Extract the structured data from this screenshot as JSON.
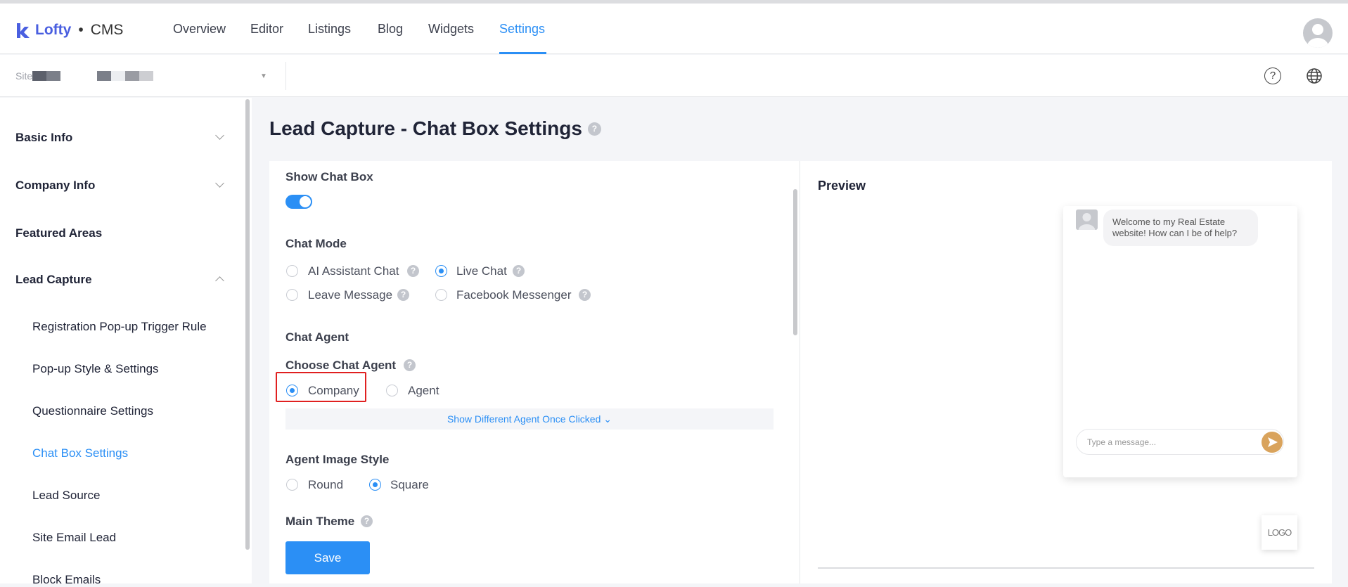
{
  "header": {
    "brand": "Lofty",
    "product": "CMS",
    "separator": "•",
    "nav": [
      "Overview",
      "Editor",
      "Listings",
      "Blog",
      "Widgets",
      "Settings"
    ],
    "active_nav": "Settings"
  },
  "subheader": {
    "site_label": "Site"
  },
  "sidebar": {
    "sections": [
      {
        "label": "Basic Info",
        "expanded": false
      },
      {
        "label": "Company Info",
        "expanded": false
      },
      {
        "label": "Featured Areas"
      },
      {
        "label": "Lead Capture",
        "expanded": true
      }
    ],
    "sub_items": [
      "Registration Pop-up Trigger Rule",
      "Pop-up Style & Settings",
      "Questionnaire Settings",
      "Chat Box Settings",
      "Lead Source",
      "Site Email Lead",
      "Block Emails"
    ],
    "active_sub": "Chat Box Settings"
  },
  "main": {
    "title": "Lead Capture - Chat Box Settings",
    "show_chat_box": {
      "label": "Show Chat Box",
      "enabled": true
    },
    "chat_mode": {
      "label": "Chat Mode",
      "options": [
        "AI Assistant Chat",
        "Live Chat",
        "Leave Message",
        "Facebook Messenger"
      ],
      "selected": "Live Chat"
    },
    "chat_agent": {
      "label": "Chat Agent",
      "choose_label": "Choose Chat Agent",
      "options": [
        "Company",
        "Agent"
      ],
      "selected": "Company",
      "expand_link": "Show Different Agent Once Clicked"
    },
    "agent_image_style": {
      "label": "Agent Image Style",
      "options": [
        "Round",
        "Square"
      ],
      "selected": "Square"
    },
    "main_theme": {
      "label": "Main Theme"
    },
    "save_label": "Save"
  },
  "preview": {
    "label": "Preview",
    "welcome_message": "Welcome to my Real Estate website! How can I be of help?",
    "input_placeholder": "Type a message...",
    "logo_text": "LOGO",
    "send_color": "#d9a35c"
  },
  "colors": {
    "accent": "#2b8ff5",
    "highlight_box": "#e02020"
  }
}
